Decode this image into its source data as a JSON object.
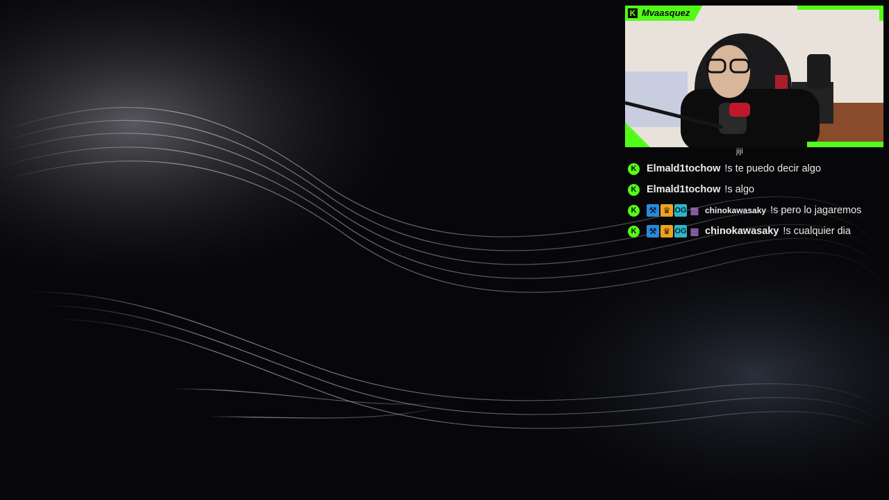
{
  "stream": {
    "streamer_name": "Mvaasquez",
    "brand_color": "#53fc18"
  },
  "chat": {
    "partial_top_text": "jiji",
    "messages": [
      {
        "user": "Elmald1tochow",
        "text": "!s te puedo decir algo",
        "badges": [
          "kick"
        ]
      },
      {
        "user": "Elmald1tochow",
        "text": "!s algo",
        "badges": [
          "kick"
        ]
      },
      {
        "user": "chinokawasaky",
        "text": "!s pero lo jagaremos",
        "badges": [
          "kick",
          "moderator",
          "vip",
          "og",
          "subscriber"
        ]
      },
      {
        "user": "chinokawasaky",
        "text": "!s cualquier dia",
        "badges": [
          "kick",
          "moderator",
          "vip",
          "og",
          "subscriber"
        ]
      }
    ]
  },
  "icons": {
    "kick_logo": "K",
    "moderator": "hammer-icon",
    "vip": "crown-icon",
    "og": "og-badge-icon",
    "subscriber": "gift-icon"
  }
}
